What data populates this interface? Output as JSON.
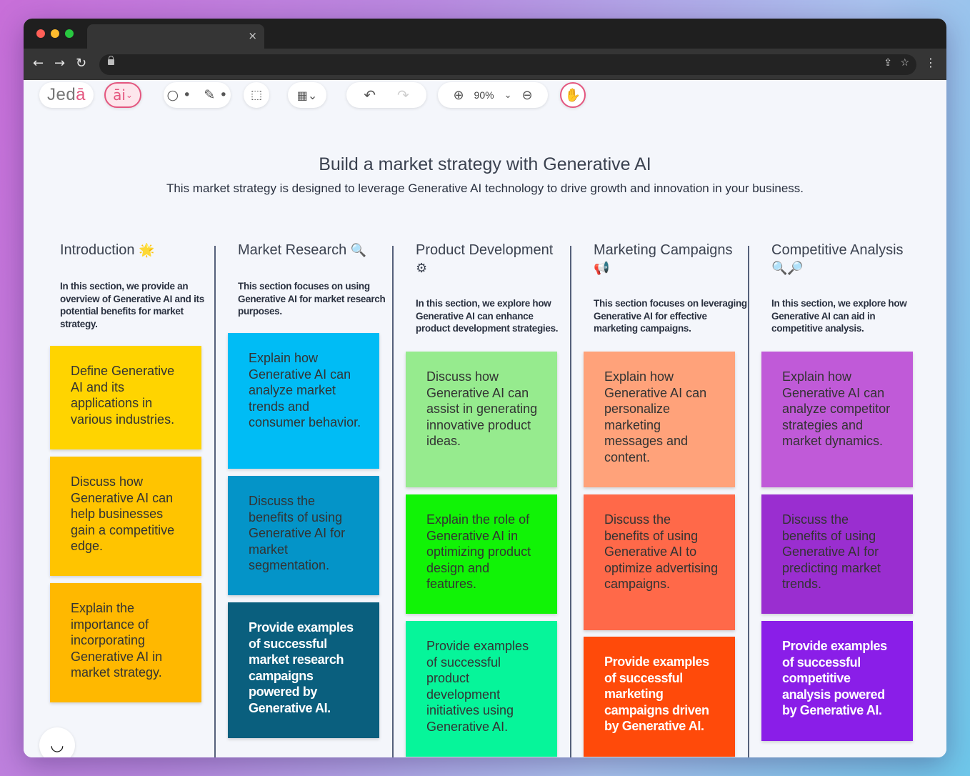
{
  "browser": {
    "tab_close": "×",
    "nav": {
      "back": "←",
      "forward": "→",
      "reload": "↻",
      "menu": "⋮"
    },
    "url_icons": {
      "share": "⇪",
      "bookmark": "☆"
    }
  },
  "toolbar": {
    "logo_main": "Jed",
    "logo_accent": "ā",
    "ai_label": "āi",
    "ai_chevron": "⌄",
    "shape_glyph": "○ •",
    "pen_glyph": "✎ •",
    "select_glyph": "⬚",
    "insert_glyph": "▦⌄",
    "undo_glyph": "↶",
    "redo_glyph": "↷",
    "zoom_in_glyph": "⊕",
    "zoom_level": "90%",
    "zoom_chevron": "⌄",
    "zoom_out_glyph": "⊖",
    "hand_glyph": "✋"
  },
  "board": {
    "title": "Build a market strategy with Generative AI",
    "subtitle": "This market strategy is designed to leverage Generative AI technology to drive growth and innovation in your business."
  },
  "columns": [
    {
      "heading": "Introduction",
      "emoji": "🌟",
      "description": "In this section, we provide an overview of Generative AI and its potential benefits for market strategy.",
      "notes": [
        {
          "text": "Define Generative AI and its applications in various industries.",
          "bg": "#ffd400",
          "color": "#333333"
        },
        {
          "text": "Discuss how Generative AI can help businesses gain a competitive edge.",
          "bg": "#ffc400",
          "color": "#333333"
        },
        {
          "text": "Explain the importance of incorporating Generative AI in market strategy.",
          "bg": "#ffb800",
          "color": "#333333"
        }
      ]
    },
    {
      "heading": "Market Research",
      "emoji": "🔍",
      "description": "This section focuses on using Generative AI for market research purposes.",
      "notes": [
        {
          "text": "Explain how Generative AI can analyze market trends and consumer behavior.",
          "bg": "#00bcf5",
          "color": "#333333"
        },
        {
          "text": "Discuss the benefits of using Generative AI for market segmentation.",
          "bg": "#0494c8",
          "color": "#333333"
        },
        {
          "text": "Provide examples of successful market research campaigns powered by Generative AI.",
          "bg": "#0a5f7e",
          "color": "#ffffff"
        }
      ]
    },
    {
      "heading": "Product Development",
      "emoji": "⚙",
      "description": "In this section, we explore how Generative AI can enhance product development strategies.",
      "notes": [
        {
          "text": "Discuss how Generative AI can assist in generating innovative product ideas.",
          "bg": "#96eb8e",
          "color": "#333333"
        },
        {
          "text": "Explain the role of Generative AI in optimizing product design and features.",
          "bg": "#11f306",
          "color": "#333333"
        },
        {
          "text": "Provide examples of successful product development initiatives using Generative AI.",
          "bg": "#06f59a",
          "color": "#333333"
        }
      ]
    },
    {
      "heading": "Marketing Campaigns",
      "emoji": "📢",
      "description": "This section focuses on leveraging Generative AI for effective marketing campaigns.",
      "notes": [
        {
          "text": "Explain how Generative AI can personalize marketing messages and content.",
          "bg": "#ffa27a",
          "color": "#333333"
        },
        {
          "text": "Discuss the benefits of using Generative AI to optimize advertising campaigns.",
          "bg": "#ff6949",
          "color": "#333333"
        },
        {
          "text": "Provide examples of successful marketing campaigns driven by Generative AI.",
          "bg": "#ff4a0a",
          "color": "#ffffff"
        }
      ]
    },
    {
      "heading": "Competitive Analysis",
      "emoji": "🔍🔎",
      "description": "In this section, we explore how Generative AI can aid in competitive analysis.",
      "notes": [
        {
          "text": "Explain how Generative AI can analyze competitor strategies and market dynamics.",
          "bg": "#c05ad8",
          "color": "#333333"
        },
        {
          "text": "Discuss the benefits of using Generative AI for predicting market trends.",
          "bg": "#9a2ed0",
          "color": "#333333"
        },
        {
          "text": "Provide examples of successful competitive analysis powered by Generative AI.",
          "bg": "#8a1ee8",
          "color": "#ffffff"
        }
      ]
    }
  ],
  "chat_glyph": "◡"
}
